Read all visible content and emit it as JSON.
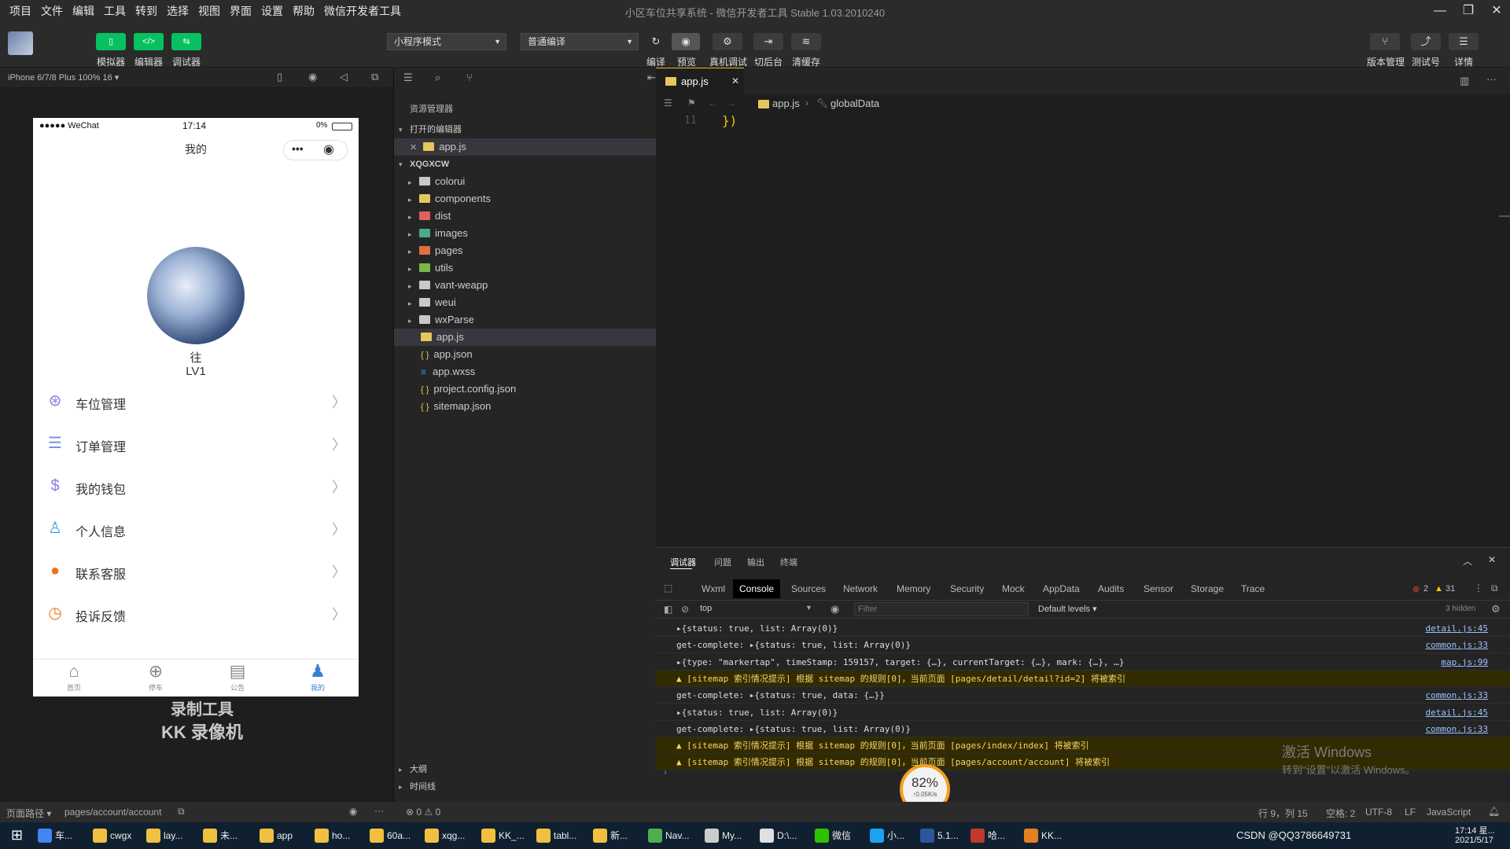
{
  "window": {
    "title": "小区车位共享系统 - 微信开发者工具 Stable 1.03.2010240",
    "menu": [
      "项目",
      "文件",
      "编辑",
      "工具",
      "转到",
      "选择",
      "视图",
      "界面",
      "设置",
      "帮助",
      "微信开发者工具"
    ]
  },
  "toolbar": {
    "simulator_label": "模拟器",
    "editor_label": "编辑器",
    "debugger_label": "调试器",
    "mode_select": "小程序模式",
    "compile_select": "普通编译",
    "compile_label": "编译",
    "preview_label": "预览",
    "remote_debug_label": "真机调试",
    "background_label": "切后台",
    "clear_cache_label": "清缓存",
    "version_label": "版本管理",
    "test_label": "测试号",
    "details_label": "详情"
  },
  "simulator": {
    "device": "iPhone 6/7/8 Plus 100% 16 ▾",
    "status_carrier": "●●●●● WeChat",
    "status_time": "17:14",
    "status_battery": "0%",
    "page_title": "我的",
    "user_name": "往",
    "user_level": "LV1",
    "menu_items": [
      {
        "label": "车位管理",
        "icon": "parking-icon",
        "color": "#8a7be0"
      },
      {
        "label": "订单管理",
        "icon": "list-icon",
        "color": "#7a8fd6"
      },
      {
        "label": "我的钱包",
        "icon": "wallet-icon",
        "color": "#8a7be0"
      },
      {
        "label": "个人信息",
        "icon": "user-icon",
        "color": "#3aa0e8"
      },
      {
        "label": "联系客服",
        "icon": "service-icon",
        "color": "#f07020"
      },
      {
        "label": "投诉反馈",
        "icon": "feedback-icon",
        "color": "#f07020"
      }
    ],
    "tabs": [
      "首页",
      "停车",
      "公告",
      "我的"
    ],
    "watermark_line1": "录制工具",
    "watermark_line2": "KK 录像机"
  },
  "explorer": {
    "title": "资源管理器",
    "open_editors": "打开的编辑器",
    "open_file": "app.js",
    "project": "XQGXCW",
    "folders": [
      {
        "name": "colorui",
        "color": "#c8c8c8"
      },
      {
        "name": "components",
        "color": "#e5c85b"
      },
      {
        "name": "dist",
        "color": "#e06060"
      },
      {
        "name": "images",
        "color": "#4aaa88"
      },
      {
        "name": "pages",
        "color": "#e07040"
      },
      {
        "name": "utils",
        "color": "#7ab84a"
      },
      {
        "name": "vant-weapp",
        "color": "#c8c8c8"
      },
      {
        "name": "weui",
        "color": "#c8c8c8"
      },
      {
        "name": "wxParse",
        "color": "#c8c8c8"
      }
    ],
    "files": [
      {
        "name": "app.js",
        "icon": "js-file-icon"
      },
      {
        "name": "app.json",
        "icon": "json-file-icon"
      },
      {
        "name": "app.wxss",
        "icon": "wxss-file-icon"
      },
      {
        "name": "project.config.json",
        "icon": "json-file-icon"
      },
      {
        "name": "sitemap.json",
        "icon": "json-file-icon"
      }
    ],
    "outline": "大纲",
    "timeline": "时间线"
  },
  "editor": {
    "tab": "app.js",
    "breadcrumb_file": "app.js",
    "breadcrumb_symbol": "globalData",
    "line_number": "11",
    "code": "})"
  },
  "devtools": {
    "panel_tabs": [
      "调试器",
      "问题",
      "输出",
      "终端"
    ],
    "tabs": [
      "Wxml",
      "Console",
      "Sources",
      "Network",
      "Memory",
      "Security",
      "Mock",
      "AppData",
      "Audits",
      "Sensor",
      "Storage",
      "Trace"
    ],
    "active_tab": "Console",
    "errors": "2",
    "warnings": "31",
    "context": "top",
    "filter_placeholder": "Filter",
    "levels": "Default levels ▾",
    "hidden": "3 hidden",
    "logs": [
      {
        "text": "▸{status: true, list: Array(0)}",
        "src": "detail.js:45",
        "warn": false
      },
      {
        "text": "get-complete: ▸{status: true, list: Array(0)}",
        "src": "common.js:33",
        "warn": false
      },
      {
        "text": "▸{type: \"markertap\", timeStamp: 159157, target: {…}, currentTarget: {…}, mark: {…}, …}",
        "src": "map.js:99",
        "warn": false
      },
      {
        "text": "▲ [sitemap 索引情况提示] 根据 sitemap 的规则[0]，当前页面 [pages/detail/detail?id=2] 将被索引",
        "src": "",
        "warn": true
      },
      {
        "text": "get-complete: ▸{status: true, data: {…}}",
        "src": "common.js:33",
        "warn": false
      },
      {
        "text": "▸{status: true, list: Array(0)}",
        "src": "detail.js:45",
        "warn": false
      },
      {
        "text": "get-complete: ▸{status: true, list: Array(0)}",
        "src": "common.js:33",
        "warn": false
      },
      {
        "text": "▲ [sitemap 索引情况提示] 根据 sitemap 的规则[0]，当前页面 [pages/index/index] 将被索引",
        "src": "",
        "warn": true
      },
      {
        "text": "▲ [sitemap 索引情况提示] 根据 sitemap 的规则[0]，当前页面 [pages/account/account] 将被索引",
        "src": "",
        "warn": true
      }
    ],
    "activate_title": "激活 Windows",
    "activate_sub": "转到\"设置\"以激活 Windows。",
    "net_percent": "82%",
    "net_speed": "↑0.05K/s"
  },
  "status": {
    "page_path_label": "页面路径 ▾",
    "page_path": "pages/account/account",
    "problems": "⊗ 0 ⚠ 0",
    "cursor": "行 9，列 15",
    "indent": "空格: 2",
    "encoding": "UTF-8",
    "eol": "LF",
    "language": "JavaScript"
  },
  "taskbar": {
    "items": [
      "车...",
      "cwgx",
      "lay...",
      "未...",
      "app",
      "ho...",
      "60a...",
      "xqg...",
      "KK_...",
      "tabl...",
      "新...",
      "Nav...",
      "My...",
      "D:\\...",
      "微信",
      "小...",
      "5.1...",
      "哈...",
      "KK..."
    ],
    "tray_text": "CSDN @QQ3786649731",
    "clock": "17:14 星...",
    "date": "2021/5/17"
  }
}
